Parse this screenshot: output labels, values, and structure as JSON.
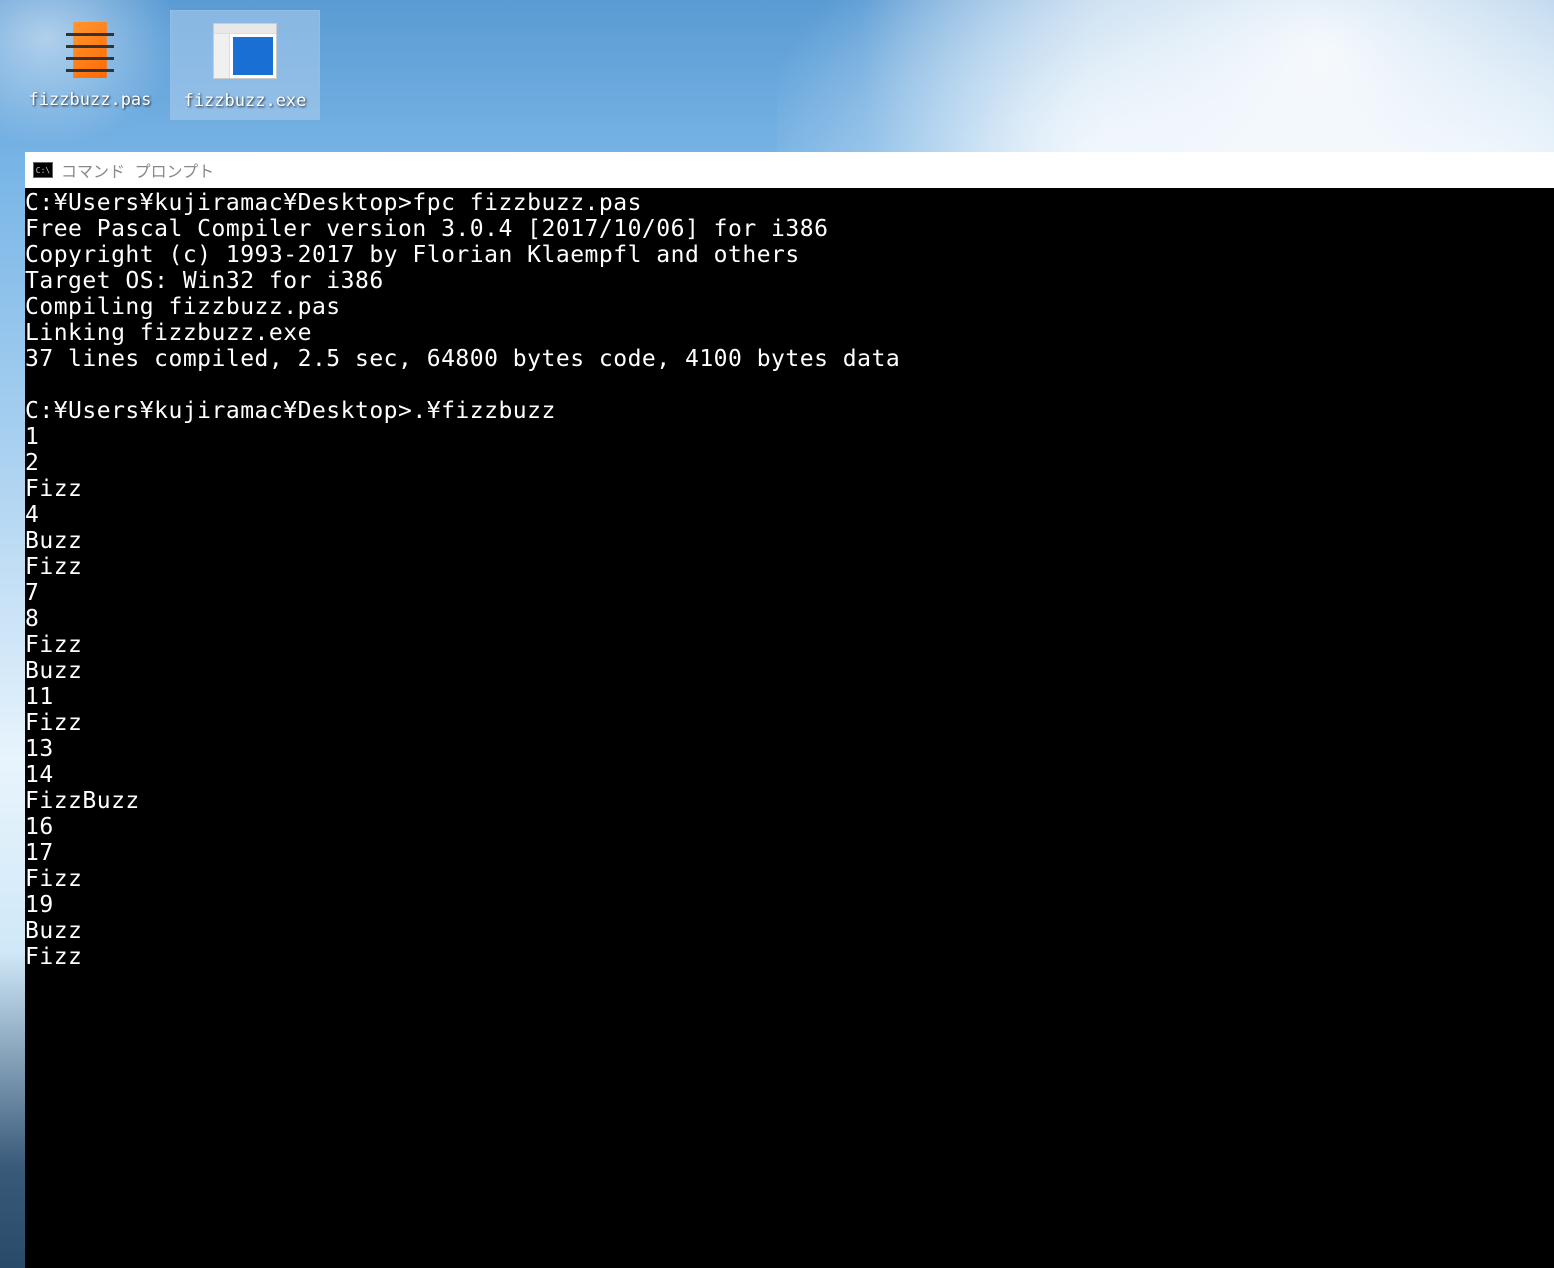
{
  "desktop": {
    "icons": [
      {
        "label": "fizzbuzz.pas",
        "type": "pas",
        "selected": false
      },
      {
        "label": "fizzbuzz.exe",
        "type": "exe",
        "selected": true
      }
    ]
  },
  "cmd_window": {
    "title": "コマンド プロンプト",
    "icon_text": "C:\\",
    "lines": [
      "C:¥Users¥kujiramac¥Desktop>fpc fizzbuzz.pas",
      "Free Pascal Compiler version 3.0.4 [2017/10/06] for i386",
      "Copyright (c) 1993-2017 by Florian Klaempfl and others",
      "Target OS: Win32 for i386",
      "Compiling fizzbuzz.pas",
      "Linking fizzbuzz.exe",
      "37 lines compiled, 2.5 sec, 64800 bytes code, 4100 bytes data",
      "",
      "C:¥Users¥kujiramac¥Desktop>.¥fizzbuzz",
      "1",
      "2",
      "Fizz",
      "4",
      "Buzz",
      "Fizz",
      "7",
      "8",
      "Fizz",
      "Buzz",
      "11",
      "Fizz",
      "13",
      "14",
      "FizzBuzz",
      "16",
      "17",
      "Fizz",
      "19",
      "Buzz",
      "Fizz"
    ]
  }
}
